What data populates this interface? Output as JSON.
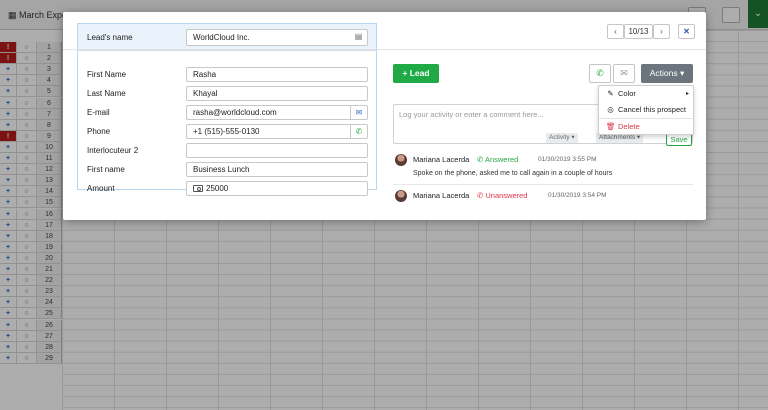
{
  "background": {
    "title": "March Expo",
    "row_numbers": [
      "1",
      "2",
      "3",
      "4",
      "5",
      "6",
      "7",
      "8",
      "9",
      "10",
      "11",
      "12",
      "13",
      "14",
      "15",
      "16",
      "17",
      "18",
      "19",
      "20",
      "21",
      "22",
      "23",
      "24",
      "25",
      "26",
      "27",
      "28",
      "29"
    ]
  },
  "modal": {
    "nav": {
      "prev": "‹",
      "counter": "10/13",
      "next": "›",
      "close": "✕"
    },
    "form": {
      "leads_name_label": "Lead's name",
      "leads_name_value": "WorldCloud Inc.",
      "first_name_label": "First Name",
      "first_name_value": "Rasha",
      "last_name_label": "Last Name",
      "last_name_value": "Khayal",
      "email_label": "E-mail",
      "email_value": "rasha@worldcloud.com",
      "phone_label": "Phone",
      "phone_value": "+1 (515)-555-0130",
      "interlocuteur_label": "Interlocuteur 2",
      "interlocuteur_value": "",
      "first_name2_label": "First name",
      "first_name2_value": "Business Lunch",
      "amount_label": "Amount",
      "amount_value": "25000"
    },
    "toolbar": {
      "lead_label": "+ Lead",
      "actions_label": "Actions ▾"
    },
    "actions_menu": {
      "color": "Color",
      "cancel": "Cancel this prospect",
      "delete": "Delete"
    },
    "comment": {
      "placeholder": "Log your activity or enter a comment here...",
      "activity_tag": "Activity ▾",
      "attachments_tag": "Attachments ▾",
      "save_label": "Save"
    },
    "activities": [
      {
        "name": "Mariana Lacerda",
        "status": "Answered",
        "date": "01/30/2019 3:55 PM",
        "text": "Spoke on the phone, asked me to call again in a couple of hours"
      },
      {
        "name": "Mariana Lacerda",
        "status": "Unanswered",
        "date": "01/30/2019 3:54 PM",
        "text": ""
      }
    ]
  },
  "colors": {
    "green": "#1faa46",
    "answered": "#28a745",
    "unanswered": "#dc3545",
    "delete": "#dc3545",
    "actions_gray": "#6c757d",
    "form_header": "#eaf3fc"
  }
}
